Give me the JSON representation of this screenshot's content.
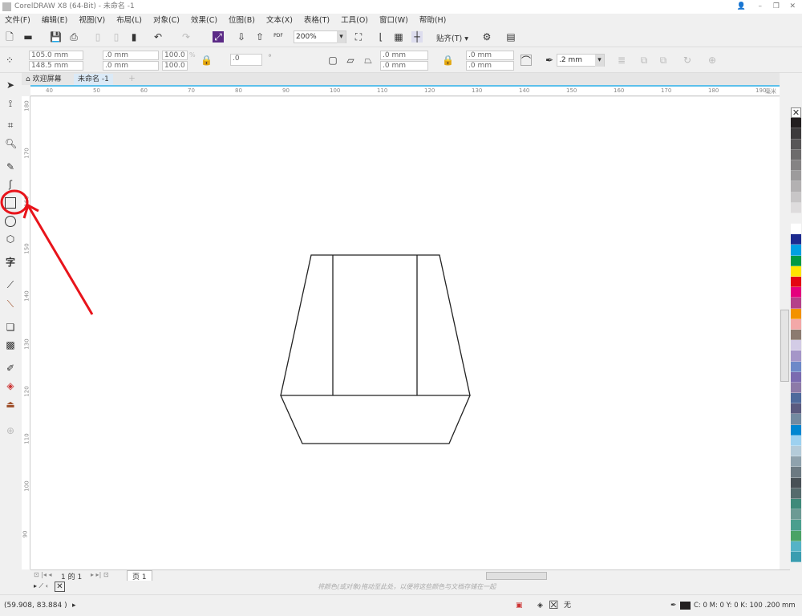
{
  "title": "CorelDRAW X8 (64-Bit) - 未命名 -1",
  "menu": [
    "文件(F)",
    "编辑(E)",
    "视图(V)",
    "布局(L)",
    "对象(C)",
    "效果(C)",
    "位图(B)",
    "文本(X)",
    "表格(T)",
    "工具(O)",
    "窗口(W)",
    "帮助(H)"
  ],
  "toolbar": {
    "zoom": "200%",
    "snap": "贴齐(T)",
    "pdf": "PDF"
  },
  "props": {
    "x": "105.0 mm",
    "y": "148.5 mm",
    "w": ".0 mm",
    "h": ".0 mm",
    "sx": "100.0",
    "sy": "100.0",
    "pct": "%",
    "angle": ".0",
    "deg": "°",
    "c1": ".0 mm",
    "c2": ".0 mm",
    "c3": ".0 mm",
    "c4": ".0 mm",
    "outline": ".2 mm"
  },
  "tabs": [
    {
      "label": "欢迎屏幕"
    },
    {
      "label": "未命名 -1"
    }
  ],
  "ruler": {
    "unit": "毫米",
    "h": [
      "40",
      "50",
      "60",
      "70",
      "80",
      "90",
      "100",
      "110",
      "120",
      "130",
      "140",
      "150",
      "160",
      "170",
      "180",
      "190"
    ],
    "v": [
      "180",
      "170",
      "160",
      "150",
      "140",
      "130",
      "120",
      "110",
      "100",
      "90"
    ]
  },
  "page_nav": {
    "count": "1 的 1",
    "page": "页 1"
  },
  "docpalette_hint": "将颜色(或对象)拖动至此处，以便将这些颜色与文档存储在一起",
  "status": {
    "coords": "(59.908, 83.884 )",
    "fill": "无",
    "outline_info": "C: 0 M: 0 Y: 0 K: 100  .200 mm"
  },
  "palette": [
    "#231f20",
    "#3d3b3c",
    "#585657",
    "#6d6b6c",
    "#858384",
    "#9d9b9c",
    "#b3b1b2",
    "#c8c6c7",
    "#dedcdd",
    "#f0f0f0",
    "#ffffff",
    "#1d2b8f",
    "#00a0e3",
    "#009a44",
    "#ffe600",
    "#e30613",
    "#e5007e",
    "#b5418a",
    "#f39200",
    "#f3a8a8",
    "#8c7b70",
    "#d3cce6",
    "#a596c8",
    "#6e89c8",
    "#7b6bb0",
    "#8d7aa8",
    "#4f6a9c",
    "#5b5a7f",
    "#738aa0",
    "#0086d1",
    "#9dd1f0",
    "#b4cbd9",
    "#8fa2ad",
    "#6c7a82",
    "#485156",
    "#556b6d",
    "#3f8a7a",
    "#6c9a94",
    "#4a9f8e",
    "#4aa366",
    "#55b3c6",
    "#3a9db0"
  ]
}
